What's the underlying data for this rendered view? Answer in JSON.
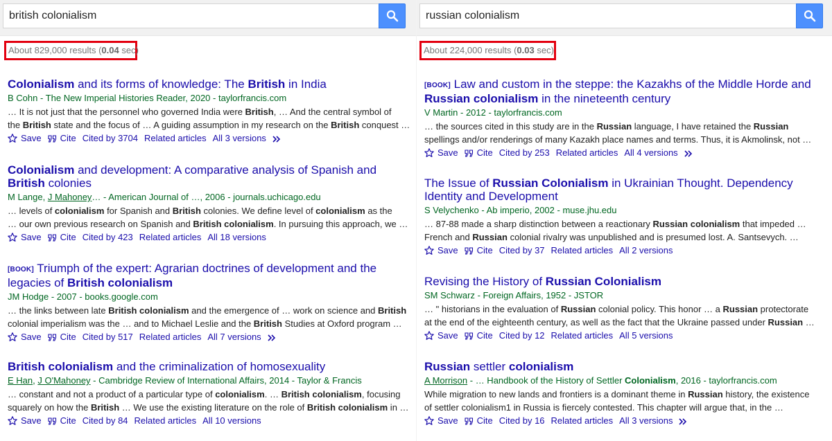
{
  "accent_color": "#1a0dab",
  "author_color": "#006621",
  "highlight_box_color": "#e3000f",
  "left": {
    "query": "british colonialism",
    "stats": {
      "prefix": "About 829,000 results (",
      "time": "0.04",
      "suffix": " sec)"
    },
    "results": [
      {
        "tag": "",
        "title_parts": [
          {
            "t": "Colonialism",
            "b": true
          },
          {
            "t": " and its forms of knowledge: The ",
            "b": false
          },
          {
            "t": "British",
            "b": true
          },
          {
            "t": " in India",
            "b": false
          }
        ],
        "author_parts": [
          {
            "t": "B Cohn - The New Imperial Histories Reader, 2020 - taylorfrancis.com",
            "u": false
          }
        ],
        "snippet1": [
          {
            "t": "… It is not just that the personnel who governed India were ",
            "b": false
          },
          {
            "t": "British",
            "b": true
          },
          {
            "t": ", … And the central symbol of",
            "b": false
          }
        ],
        "snippet2": [
          {
            "t": "the ",
            "b": false
          },
          {
            "t": "British",
            "b": true
          },
          {
            "t": " state and the focus of … A guiding assumption in my research on the ",
            "b": false
          },
          {
            "t": "British",
            "b": true
          },
          {
            "t": " conquest …",
            "b": false
          }
        ],
        "actions": {
          "save": "Save",
          "cite": "Cite",
          "cited": "Cited by 3704",
          "related": "Related articles",
          "versions": "All 3 versions",
          "more": true
        }
      },
      {
        "tag": "",
        "title_parts": [
          {
            "t": "Colonialism",
            "b": true
          },
          {
            "t": " and development: A comparative analysis of Spanish and ",
            "b": false
          },
          {
            "t": "British",
            "b": true
          },
          {
            "t": " colonies",
            "b": false
          }
        ],
        "author_parts": [
          {
            "t": "M Lange, ",
            "u": false
          },
          {
            "t": "J Mahoney",
            "u": true
          },
          {
            "t": "… - American Journal of …, 2006 - journals.uchicago.edu",
            "u": false
          }
        ],
        "snippet1": [
          {
            "t": "… levels of ",
            "b": false
          },
          {
            "t": "colonialism",
            "b": true
          },
          {
            "t": " for Spanish and ",
            "b": false
          },
          {
            "t": "British",
            "b": true
          },
          {
            "t": " colonies. We define level of ",
            "b": false
          },
          {
            "t": "colonialism",
            "b": true
          },
          {
            "t": " as the",
            "b": false
          }
        ],
        "snippet2": [
          {
            "t": "… our own previous research on Spanish and ",
            "b": false
          },
          {
            "t": "British colonialism",
            "b": true
          },
          {
            "t": ". In pursuing this approach, we …",
            "b": false
          }
        ],
        "actions": {
          "save": "Save",
          "cite": "Cite",
          "cited": "Cited by 423",
          "related": "Related articles",
          "versions": "All 18 versions",
          "more": false
        }
      },
      {
        "tag": "[BOOK]",
        "title_parts": [
          {
            "t": "Triumph of the expert: Agrarian doctrines of development and the legacies of ",
            "b": false
          },
          {
            "t": "British colonialism",
            "b": true
          }
        ],
        "author_parts": [
          {
            "t": "JM Hodge - 2007 - books.google.com",
            "u": false
          }
        ],
        "snippet1": [
          {
            "t": "… the links between late ",
            "b": false
          },
          {
            "t": "British colonialism",
            "b": true
          },
          {
            "t": " and the emergence of … work on science and ",
            "b": false
          },
          {
            "t": "British",
            "b": true
          }
        ],
        "snippet2": [
          {
            "t": "colonial imperialism was the … and to Michael Leslie and the ",
            "b": false
          },
          {
            "t": "British",
            "b": true
          },
          {
            "t": " Studies at Oxford program …",
            "b": false
          }
        ],
        "actions": {
          "save": "Save",
          "cite": "Cite",
          "cited": "Cited by 517",
          "related": "Related articles",
          "versions": "All 7 versions",
          "more": true
        }
      },
      {
        "tag": "",
        "title_parts": [
          {
            "t": "British colonialism",
            "b": true
          },
          {
            "t": " and the criminalization of homosexuality",
            "b": false
          }
        ],
        "author_parts": [
          {
            "t": "E Han",
            "u": true
          },
          {
            "t": ", ",
            "u": false
          },
          {
            "t": "J O'Mahoney",
            "u": true
          },
          {
            "t": " - Cambridge Review of International Affairs, 2014 - Taylor & Francis",
            "u": false
          }
        ],
        "snippet1": [
          {
            "t": "… constant and not a product of a particular type of ",
            "b": false
          },
          {
            "t": "colonialism",
            "b": true
          },
          {
            "t": ". … ",
            "b": false
          },
          {
            "t": "British colonialism",
            "b": true
          },
          {
            "t": ", focusing",
            "b": false
          }
        ],
        "snippet2": [
          {
            "t": "squarely on how the ",
            "b": false
          },
          {
            "t": "British",
            "b": true
          },
          {
            "t": " … We use the existing literature on the role of ",
            "b": false
          },
          {
            "t": "British colonialism",
            "b": true
          },
          {
            "t": " in …",
            "b": false
          }
        ],
        "actions": {
          "save": "Save",
          "cite": "Cite",
          "cited": "Cited by 84",
          "related": "Related articles",
          "versions": "All 10 versions",
          "more": false
        }
      }
    ]
  },
  "right": {
    "query": "russian colonialism",
    "stats": {
      "prefix": "About 224,000 results (",
      "time": "0.03",
      "suffix": " sec)"
    },
    "results": [
      {
        "tag": "[BOOK]",
        "title_parts": [
          {
            "t": "Law and custom in the steppe: the Kazakhs of the Middle Horde and ",
            "b": false
          },
          {
            "t": "Russian colonialism",
            "b": true
          },
          {
            "t": " in the nineteenth century",
            "b": false
          }
        ],
        "author_parts": [
          {
            "t": "V Martin - 2012 - taylorfrancis.com",
            "u": false
          }
        ],
        "snippet1": [
          {
            "t": "… the sources cited in this study are in the ",
            "b": false
          },
          {
            "t": "Russian",
            "b": true
          },
          {
            "t": " language, I have retained the ",
            "b": false
          },
          {
            "t": "Russian",
            "b": true
          }
        ],
        "snippet2": [
          {
            "t": "spellings and/or renderings of many Kazakh place names and terms. Thus, it is Akmolinsk, not …",
            "b": false
          }
        ],
        "actions": {
          "save": "Save",
          "cite": "Cite",
          "cited": "Cited by 253",
          "related": "Related articles",
          "versions": "All 4 versions",
          "more": true
        }
      },
      {
        "tag": "",
        "title_parts": [
          {
            "t": "The Issue of ",
            "b": false
          },
          {
            "t": "Russian Colonialism",
            "b": true
          },
          {
            "t": " in Ukrainian Thought. Dependency Identity and Development",
            "b": false
          }
        ],
        "author_parts": [
          {
            "t": "S Velychenko - Ab imperio, 2002 - muse.jhu.edu",
            "u": false
          }
        ],
        "snippet1": [
          {
            "t": "… 87-88 made a sharp distinction between a reactionary ",
            "b": false
          },
          {
            "t": "Russian colonialism",
            "b": true
          },
          {
            "t": " that impeded …",
            "b": false
          }
        ],
        "snippet2": [
          {
            "t": "French and ",
            "b": false
          },
          {
            "t": "Russian",
            "b": true
          },
          {
            "t": " colonial rivalry was unpublished and is presumed lost. A. Santsevych. …",
            "b": false
          }
        ],
        "actions": {
          "save": "Save",
          "cite": "Cite",
          "cited": "Cited by 37",
          "related": "Related articles",
          "versions": "All 2 versions",
          "more": false
        }
      },
      {
        "tag": "",
        "title_parts": [
          {
            "t": "Revising the History of ",
            "b": false
          },
          {
            "t": "Russian Colonialism",
            "b": true
          }
        ],
        "author_parts": [
          {
            "t": "SM Schwarz - Foreign Affairs, 1952 - JSTOR",
            "u": false
          }
        ],
        "snippet1": [
          {
            "t": "… \" historians in the evaluation of ",
            "b": false
          },
          {
            "t": "Russian",
            "b": true
          },
          {
            "t": " colonial policy. This honor … a ",
            "b": false
          },
          {
            "t": "Russian",
            "b": true
          },
          {
            "t": " protectorate",
            "b": false
          }
        ],
        "snippet2": [
          {
            "t": "at the end of the eighteenth century, as well as the fact that the Ukraine passed under ",
            "b": false
          },
          {
            "t": "Russian",
            "b": true
          },
          {
            "t": " …",
            "b": false
          }
        ],
        "actions": {
          "save": "Save",
          "cite": "Cite",
          "cited": "Cited by 12",
          "related": "Related articles",
          "versions": "All 5 versions",
          "more": false
        }
      },
      {
        "tag": "",
        "title_parts": [
          {
            "t": "Russian",
            "b": true
          },
          {
            "t": " settler ",
            "b": false
          },
          {
            "t": "colonialism",
            "b": true
          }
        ],
        "author_parts": [
          {
            "t": "A Morrison",
            "u": true
          },
          {
            "t": " - … Handbook of the History of Settler ",
            "u": false
          },
          {
            "t": "Colonialism",
            "u": false,
            "b": true
          },
          {
            "t": ", 2016 - taylorfrancis.com",
            "u": false
          }
        ],
        "snippet1": [
          {
            "t": "While migration to new lands and frontiers is a dominant theme in ",
            "b": false
          },
          {
            "t": "Russian",
            "b": true
          },
          {
            "t": " history, the existence",
            "b": false
          }
        ],
        "snippet2": [
          {
            "t": "of settler colonialism1 in Russia is fiercely contested. This chapter will argue that, in the …",
            "b": false
          }
        ],
        "actions": {
          "save": "Save",
          "cite": "Cite",
          "cited": "Cited by 16",
          "related": "Related articles",
          "versions": "All 3 versions",
          "more": true
        }
      }
    ]
  }
}
